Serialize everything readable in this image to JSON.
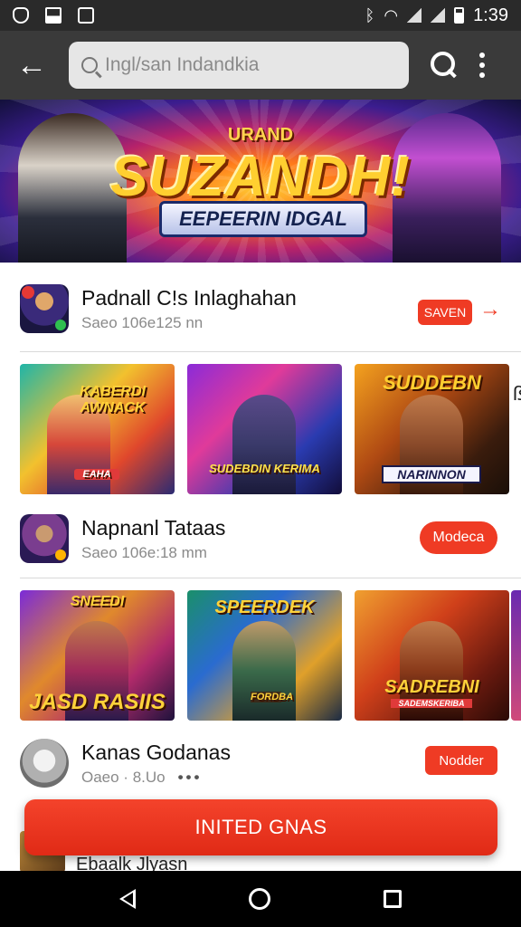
{
  "status": {
    "time": "1:39",
    "icons": [
      "shield-icon",
      "image-icon",
      "screenshot-icon",
      "bluetooth-icon",
      "wifi-icon",
      "signal-icon",
      "signal-icon",
      "battery-icon"
    ]
  },
  "toolbar": {
    "search_placeholder": "Ingl/san Indandkia"
  },
  "banner": {
    "top": "URAND",
    "title": "SUZANDH!",
    "sub": "EEPEERIN IDGAL"
  },
  "items": [
    {
      "title": "Padnall C!s Inlaghahan",
      "sub": "Saeo 106e125 nn",
      "button": "SAVEN",
      "arrow": "→"
    },
    {
      "title": "Napnanl Tataas",
      "sub": "Saeo 106e:18 mm",
      "button": "Modeca"
    },
    {
      "title": "Kanas Godanas",
      "sub": "Oaeo · 8.Uo",
      "dots": "•••",
      "button": "Nodder"
    }
  ],
  "cards_row1": [
    {
      "label": "KABERDI AWNACK",
      "tag": "EAHA"
    },
    {
      "label": "SUDEBDIN KERIMA"
    },
    {
      "label": "SUDDEBN",
      "tag": "NARINNON"
    }
  ],
  "cards_row1_tail": "ß",
  "cards_row2": [
    {
      "label": "SNEEDI",
      "tag": "JASD RASIIS"
    },
    {
      "label": "SPEERDEK",
      "tag": "FORDBA"
    },
    {
      "label": "SADREBNI",
      "tag": "SADEMSKERIBA"
    }
  ],
  "partial": {
    "text": "Ebaalk Jlyasn"
  },
  "fab": {
    "label": "INITED GNAS"
  },
  "colors": {
    "accent": "#ef3b24",
    "toolbar": "#3a3a3a",
    "statusbar": "#2a2a2a"
  }
}
